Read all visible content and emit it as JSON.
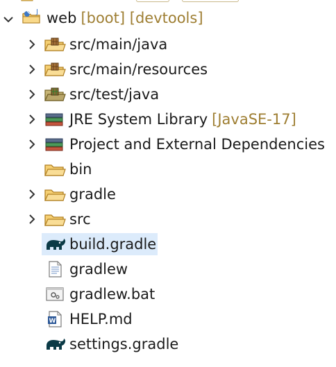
{
  "tree": {
    "root": {
      "label": "web",
      "decoration": "[boot] [devtools]",
      "icon": "java-project-icon",
      "expanded": true
    },
    "items": [
      {
        "label": "src/main/java",
        "icon": "source-folder-icon",
        "expandable": true
      },
      {
        "label": "src/main/resources",
        "icon": "source-folder-icon",
        "expandable": true
      },
      {
        "label": "src/test/java",
        "icon": "test-source-folder-icon",
        "expandable": true
      },
      {
        "label": "JRE System Library",
        "decoration": "[JavaSE-17]",
        "icon": "library-icon",
        "expandable": true
      },
      {
        "label": "Project and External Dependencies",
        "icon": "library-icon",
        "expandable": true
      },
      {
        "label": "bin",
        "icon": "folder-icon",
        "expandable": false
      },
      {
        "label": "gradle",
        "icon": "folder-icon",
        "expandable": true
      },
      {
        "label": "src",
        "icon": "folder-icon",
        "expandable": true
      },
      {
        "label": "build.gradle",
        "icon": "gradle-elephant-icon",
        "expandable": false,
        "selected": true
      },
      {
        "label": "gradlew",
        "icon": "text-file-icon",
        "expandable": false
      },
      {
        "label": "gradlew.bat",
        "icon": "batch-file-icon",
        "expandable": false
      },
      {
        "label": "HELP.md",
        "icon": "word-document-icon",
        "expandable": false
      },
      {
        "label": "settings.gradle",
        "icon": "gradle-elephant-icon",
        "expandable": false
      }
    ]
  },
  "colors": {
    "selection": "#dcebfb",
    "decoration": "#9e7e32",
    "folder": "#e8b64a",
    "gradle": "#0b3a46"
  }
}
